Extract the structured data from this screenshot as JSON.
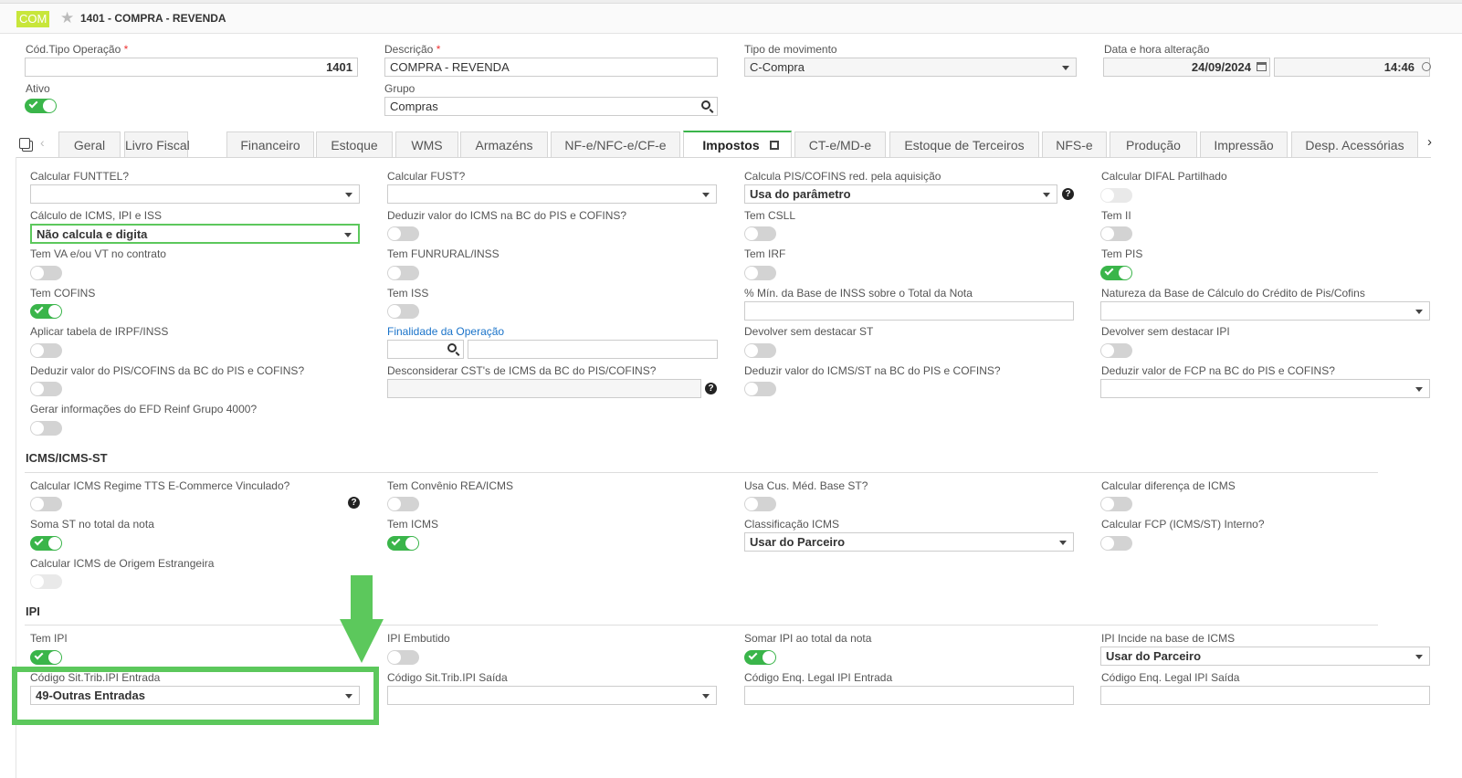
{
  "header": {
    "badge": "COM",
    "title": "1401 - COMPRA - REVENDA",
    "accent": "#c8e63b"
  },
  "form": {
    "cod_label": "Cód.Tipo Operação",
    "cod_value": "1401",
    "desc_label": "Descrição",
    "desc_value": "COMPRA - REVENDA",
    "tipo_label": "Tipo de movimento",
    "tipo_value": "C-Compra",
    "data_label": "Data e hora alteração",
    "data_value": "24/09/2024",
    "hora_value": "14:46",
    "ativo_label": "Ativo",
    "ativo_on": true,
    "grupo_label": "Grupo",
    "grupo_value": "Compras"
  },
  "tabs": [
    "Geral",
    "Livro Fiscal",
    "Financeiro",
    "Estoque",
    "WMS",
    "Armazéns",
    "NF-e/NFC-e/CF-e",
    "Impostos",
    "CT-e/MD-e",
    "Estoque de Terceiros",
    "NFS-e",
    "Produção",
    "Impressão",
    "Desp. Acessórias"
  ],
  "active_tab": "Impostos",
  "fields": {
    "funttel": "Calcular FUNTTEL?",
    "fust": "Calcular FUST?",
    "pis_red": "Calcula PIS/COFINS red. pela aquisição",
    "pis_red_value": "Usa do parâmetro",
    "difal": "Calcular DIFAL Partilhado",
    "calc_icms": "Cálculo de ICMS, IPI e ISS",
    "calc_icms_value": "Não calcula e digita",
    "deduzir_icms": "Deduzir valor do ICMS na BC do PIS e COFINS?",
    "csll": "Tem CSLL",
    "ii": "Tem II",
    "va_vt": "Tem VA e/ou VT no contrato",
    "funrural": "Tem FUNRURAL/INSS",
    "irf": "Tem IRF",
    "pis": "Tem PIS",
    "cofins": "Tem COFINS",
    "iss": "Tem ISS",
    "min_inss": "% Mín. da Base de INSS sobre o Total da Nota",
    "natureza": "Natureza da Base de Cálculo do Crédito de Pis/Cofins",
    "irpf": "Aplicar tabela de IRPF/INSS",
    "finalidade": "Finalidade da Operação",
    "dev_st": "Devolver sem destacar ST",
    "dev_ipi": "Devolver sem destacar IPI",
    "ded_pis": "Deduzir valor do PIS/COFINS da BC do PIS e COFINS?",
    "descons": "Desconsiderar CST's de ICMS da BC do PIS/COFINS?",
    "ded_icmsst": "Deduzir valor do ICMS/ST na BC do PIS e COFINS?",
    "ded_fcp": "Deduzir valor de FCP na BC do PIS e COFINS?",
    "efd": "Gerar informações do EFD Reinf Grupo 4000?"
  },
  "icms": {
    "section": "ICMS/ICMS-ST",
    "tts": "Calcular ICMS Regime TTS E-Commerce Vinculado?",
    "rea": "Tem Convênio REA/ICMS",
    "cus": "Usa Cus. Méd. Base ST?",
    "dif": "Calcular diferença de ICMS",
    "soma_st": "Soma ST no total da nota",
    "tem_icms": "Tem ICMS",
    "classif": "Classificação ICMS",
    "classif_value": "Usar do Parceiro",
    "fcp": "Calcular FCP (ICMS/ST) Interno?",
    "origem": "Calcular ICMS de Origem Estrangeira"
  },
  "ipi": {
    "section": "IPI",
    "tem_ipi": "Tem IPI",
    "embutido": "IPI Embutido",
    "somar": "Somar IPI ao total da nota",
    "incide": "IPI Incide na base de ICMS",
    "incide_value": "Usar do Parceiro",
    "cst_entrada": "Código Sit.Trib.IPI Entrada",
    "cst_entrada_value": "49-Outras Entradas",
    "cst_saida": "Código Sit.Trib.IPI Saída",
    "enq_entrada": "Código Enq. Legal IPI Entrada",
    "enq_saida": "Código Enq. Legal IPI Saída"
  },
  "annotation_color": "#5cc85c",
  "toggle_on_color": "#3ab54a"
}
